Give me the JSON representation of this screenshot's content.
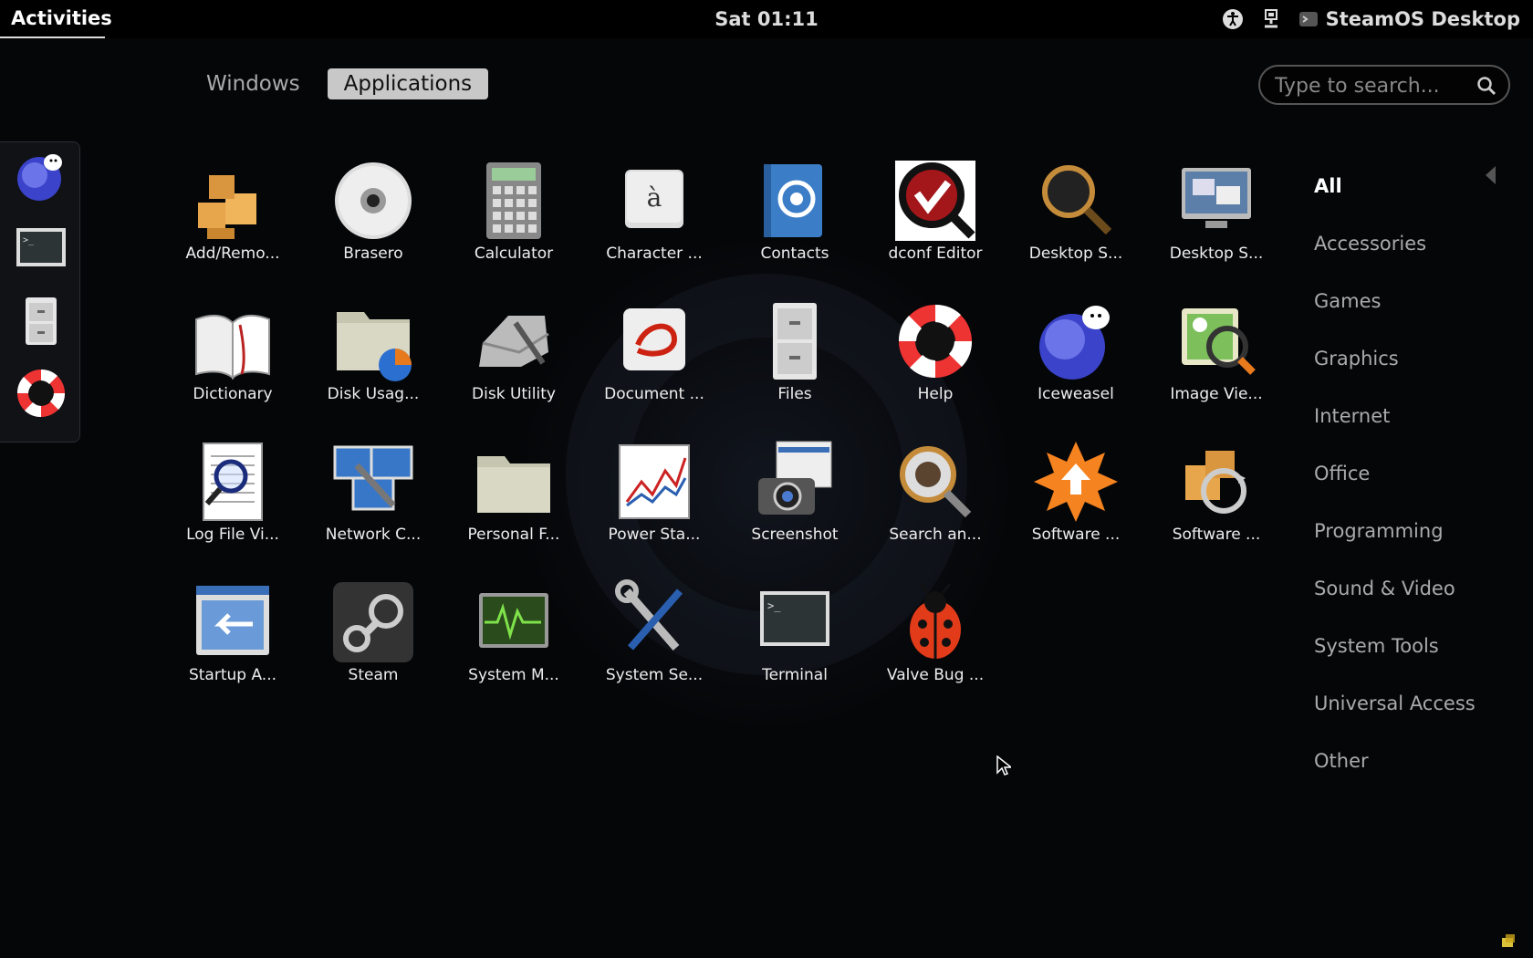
{
  "topbar": {
    "activities": "Activities",
    "clock": "Sat 01:11",
    "user": "SteamOS Desktop"
  },
  "switcher": {
    "windows": "Windows",
    "applications": "Applications"
  },
  "search": {
    "placeholder": "Type to search..."
  },
  "apps": [
    {
      "label": "Add/Remo...",
      "icon": "packages-icon"
    },
    {
      "label": "Brasero",
      "icon": "disc-icon"
    },
    {
      "label": "Calculator",
      "icon": "calculator-icon"
    },
    {
      "label": "Character ...",
      "icon": "character-map-icon"
    },
    {
      "label": "Contacts",
      "icon": "contacts-icon"
    },
    {
      "label": "dconf Editor",
      "icon": "dconf-icon"
    },
    {
      "label": "Desktop S...",
      "icon": "desktop-search-icon"
    },
    {
      "label": "Desktop S...",
      "icon": "desktop-sharing-icon"
    },
    {
      "label": "Dictionary",
      "icon": "dictionary-icon"
    },
    {
      "label": "Disk Usag...",
      "icon": "disk-usage-icon"
    },
    {
      "label": "Disk Utility",
      "icon": "disk-utility-icon"
    },
    {
      "label": "Document ...",
      "icon": "document-viewer-icon"
    },
    {
      "label": "Files",
      "icon": "files-icon",
      "running": true
    },
    {
      "label": "Help",
      "icon": "help-icon"
    },
    {
      "label": "Iceweasel",
      "icon": "iceweasel-icon",
      "running": true
    },
    {
      "label": "Image Vie...",
      "icon": "image-viewer-icon"
    },
    {
      "label": "Log File Vi...",
      "icon": "log-viewer-icon"
    },
    {
      "label": "Network C...",
      "icon": "network-icon"
    },
    {
      "label": "Personal F...",
      "icon": "personal-folder-icon"
    },
    {
      "label": "Power Sta...",
      "icon": "power-stats-icon"
    },
    {
      "label": "Screenshot",
      "icon": "screenshot-icon"
    },
    {
      "label": "Search an...",
      "icon": "search-index-icon"
    },
    {
      "label": "Software ...",
      "icon": "software-update-icon"
    },
    {
      "label": "Software ...",
      "icon": "software-sources-icon"
    },
    {
      "label": "Startup A...",
      "icon": "startup-icon"
    },
    {
      "label": "Steam",
      "icon": "steam-icon"
    },
    {
      "label": "System M...",
      "icon": "system-monitor-icon"
    },
    {
      "label": "System Se...",
      "icon": "system-settings-icon"
    },
    {
      "label": "Terminal",
      "icon": "terminal-icon",
      "running": true
    },
    {
      "label": "Valve Bug ...",
      "icon": "ladybug-icon"
    }
  ],
  "categories": [
    "All",
    "Accessories",
    "Games",
    "Graphics",
    "Internet",
    "Office",
    "Programming",
    "Sound & Video",
    "System Tools",
    "Universal Access",
    "Other"
  ],
  "dash": [
    "iceweasel-icon",
    "terminal-icon",
    "files-icon",
    "help-icon"
  ]
}
